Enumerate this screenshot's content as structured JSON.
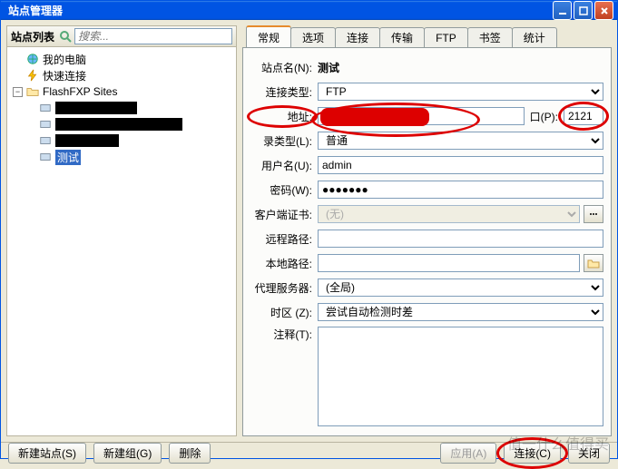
{
  "window": {
    "title": "站点管理器"
  },
  "sidebar": {
    "title": "站点列表",
    "search_placeholder": "搜索...",
    "nodes": {
      "mycomputer": "我的电脑",
      "quick": "快速连接",
      "sites": "FlashFXP Sites",
      "selected": "测试"
    }
  },
  "tabs": [
    "常规",
    "选项",
    "连接",
    "传输",
    "FTP",
    "书签",
    "统计"
  ],
  "form": {
    "sitename_label": "站点名(N):",
    "sitename_value": "测试",
    "conntype_label": "连接类型:",
    "conntype_value": "FTP",
    "address_label": "地址:",
    "port_label": "口(P):",
    "port_value": "2121",
    "logintype_label": "录类型(L):",
    "logintype_value": "普通",
    "user_label": "用户名(U):",
    "user_value": "admin",
    "pass_label": "密码(W):",
    "pass_value": "●●●●●●●",
    "cert_label": "客户端证书:",
    "cert_value": "(无)",
    "remotepath_label": "远程路径:",
    "localpath_label": "本地路径:",
    "proxy_label": "代理服务器:",
    "proxy_value": "(全局)",
    "tz_label": "时区 (Z):",
    "tz_value": "尝试自动检测时差",
    "notes_label": "注释(T):"
  },
  "footer": {
    "newsite": "新建站点(S)",
    "newgroup": "新建组(G)",
    "delete": "删除",
    "apply": "应用(A)",
    "connect": "连接(C)",
    "close": "关闭"
  },
  "watermark": "值一什么值得买"
}
